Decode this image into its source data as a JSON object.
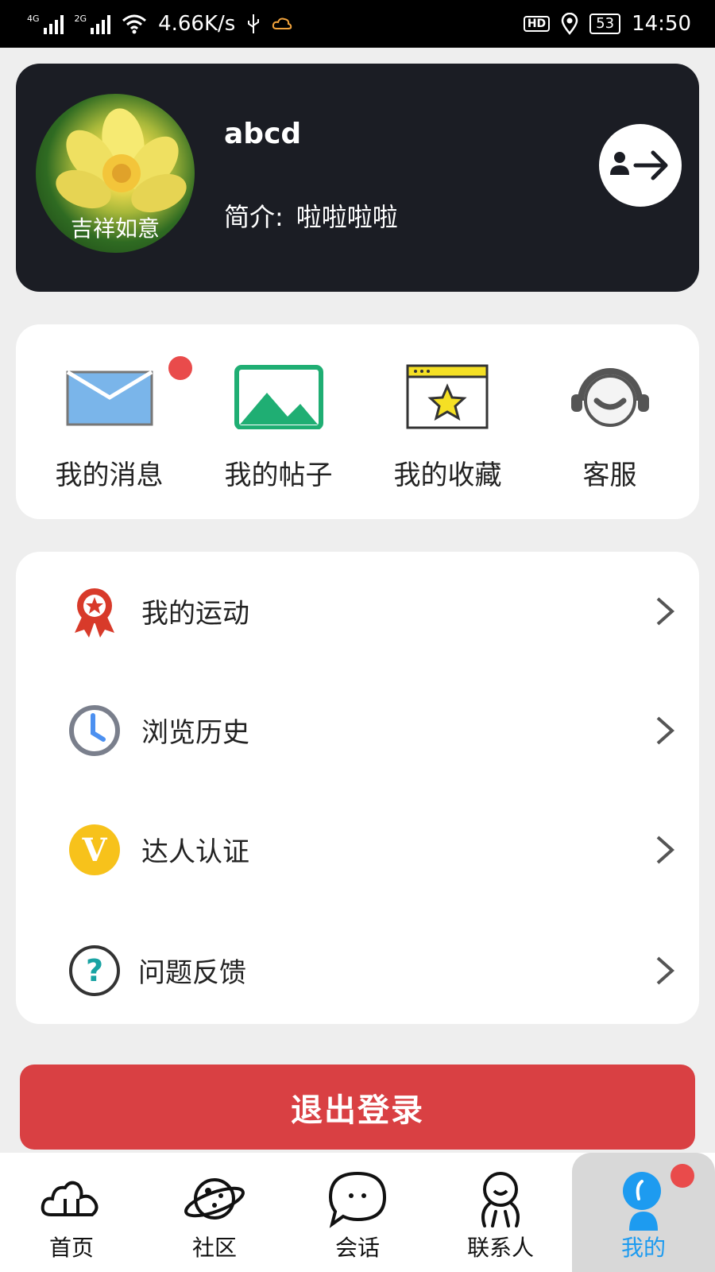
{
  "status_bar": {
    "net1": "4G",
    "net2": "2G",
    "speed": "4.66K/s",
    "hd": "HD",
    "battery": "53",
    "time": "14:50"
  },
  "profile": {
    "avatar_caption": "吉祥如意",
    "username": "abcd",
    "bio_label": "简介:",
    "bio_value": "啦啦啦啦"
  },
  "quick_actions": [
    {
      "label": "我的消息",
      "icon": "mail-icon",
      "badge": true
    },
    {
      "label": "我的帖子",
      "icon": "picture-icon",
      "badge": false
    },
    {
      "label": "我的收藏",
      "icon": "favorites-star-icon",
      "badge": false
    },
    {
      "label": "客服",
      "icon": "headset-icon",
      "badge": false
    }
  ],
  "menu": [
    {
      "label": "我的运动",
      "icon": "medal-icon"
    },
    {
      "label": "浏览历史",
      "icon": "clock-icon"
    },
    {
      "label": "达人认证",
      "icon": "verified-v-icon",
      "icon_text": "V"
    },
    {
      "label": "问题反馈",
      "icon": "question-icon",
      "icon_text": "?"
    }
  ],
  "logout_button": "退出登录",
  "nav": [
    {
      "label": "首页",
      "icon": "cloud-home-icon"
    },
    {
      "label": "社区",
      "icon": "planet-icon"
    },
    {
      "label": "会话",
      "icon": "chat-bubble-icon"
    },
    {
      "label": "联系人",
      "icon": "contacts-icon"
    },
    {
      "label": "我的",
      "icon": "profile-icon",
      "active": true,
      "badge": true
    }
  ],
  "colors": {
    "accent": "#1d9bf0",
    "logout": "#d94043",
    "badge": "#e94b4b",
    "profile_bg": "#1b1d24"
  }
}
